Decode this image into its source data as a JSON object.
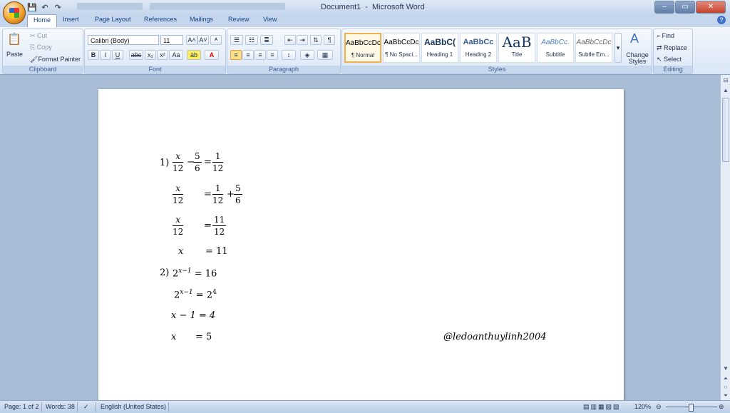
{
  "window": {
    "title_doc": "Document1",
    "title_sep": "-",
    "title_app": "Microsoft Word"
  },
  "window_buttons": {
    "minimize": "–",
    "maximize": "▭",
    "close": "✕"
  },
  "quick_access": {
    "save": "💾",
    "undo": "↶",
    "redo": "↷"
  },
  "tabs": [
    "Home",
    "Insert",
    "Page Layout",
    "References",
    "Mailings",
    "Review",
    "View"
  ],
  "help": "?",
  "clipboard": {
    "paste": "Paste",
    "cut": "Cut",
    "copy": "Copy",
    "format_painter": "Format Painter",
    "label": "Clipboard"
  },
  "font": {
    "name": "Calibri (Body)",
    "size": "11",
    "grow": "A˄",
    "shrink": "A˅",
    "clear": "ᴬ",
    "bold": "B",
    "italic": "I",
    "underline": "U",
    "strike": "abc",
    "subscript": "x₂",
    "superscript": "x²",
    "case": "Aa",
    "highlight": "ab",
    "color": "A",
    "label": "Font"
  },
  "paragraph": {
    "label": "Paragraph"
  },
  "styles": {
    "items": [
      {
        "preview": "AaBbCcDc",
        "name": "¶ Normal"
      },
      {
        "preview": "AaBbCcDc",
        "name": "¶ No Spaci..."
      },
      {
        "preview": "AaBbC(",
        "name": "Heading 1"
      },
      {
        "preview": "AaBbCc",
        "name": "Heading 2"
      },
      {
        "preview": "AaB",
        "name": "Title"
      },
      {
        "preview": "AaBbCc.",
        "name": "Subtitle"
      },
      {
        "preview": "AaBbCcDc",
        "name": "Subtle Em..."
      }
    ],
    "change": "Change Styles",
    "label": "Styles"
  },
  "editing": {
    "find": "Find",
    "replace": "Replace",
    "select": "Select",
    "label": "Editing"
  },
  "doc": {
    "p1_num": "1)",
    "p1_x": "x",
    "p1_d12": "12",
    "p1_minus": "−",
    "p1_5": "5",
    "p1_6": "6",
    "p1_eq": "=",
    "p1_1": "1",
    "p1_12b": "12",
    "p2_x": "x",
    "p2_12": "12",
    "p2_eq": "=",
    "p2_1": "1",
    "p2_12b": "12",
    "p2_plus": "+",
    "p2_5": "5",
    "p2_6": "6",
    "p3_x": "x",
    "p3_12": "12",
    "p3_eq": "=",
    "p3_11": "11",
    "p3_12b": "12",
    "p4_x": "x",
    "p4_rhs": "= 11",
    "q1_num": "2)",
    "q1_base": "2",
    "q1_exp": "x−1",
    "q1_rhs": "= 16",
    "q2_base": "2",
    "q2_exp": "x−1",
    "q2_eq": "= 2",
    "q2_exp2": "4",
    "q3_lhs": "x − 1 = 4",
    "q4_x": "x",
    "q4_rhs": "= 5",
    "watermark": "@ledoanthuylinh2004"
  },
  "status": {
    "page": "Page: 1 of 2",
    "words": "Words: 38",
    "lang": "English (United States)",
    "zoom": "120%"
  }
}
